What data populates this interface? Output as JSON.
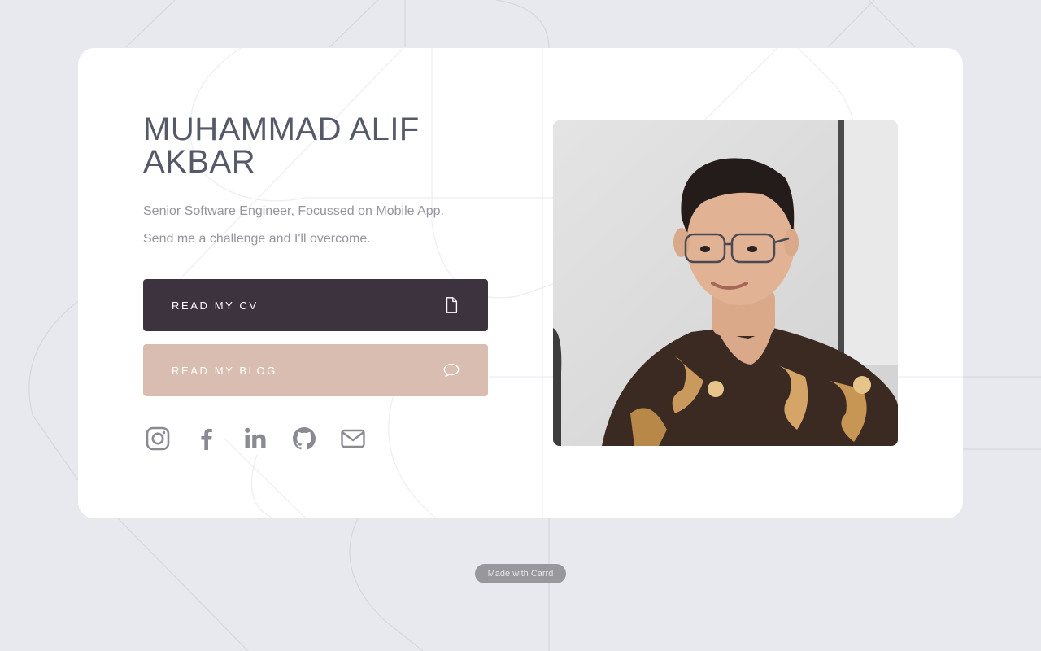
{
  "profile": {
    "name": "MUHAMMAD ALIF AKBAR",
    "tagline": "Senior Software Engineer, Focussed on Mobile App.",
    "motto": "Send me a challenge and I'll overcome."
  },
  "buttons": {
    "cv_label": "READ MY CV",
    "cv_icon": "document-icon",
    "blog_label": "READ MY BLOG",
    "blog_icon": "chat-bubble-icon"
  },
  "socials": [
    {
      "icon": "instagram-icon"
    },
    {
      "icon": "facebook-icon"
    },
    {
      "icon": "linkedin-icon"
    },
    {
      "icon": "github-icon"
    },
    {
      "icon": "email-icon"
    }
  ],
  "photo": {
    "icon": "profile-photo"
  },
  "footer": {
    "badge": "Made with Carrd"
  },
  "colors": {
    "background": "#e8e9ee",
    "card": "#ffffff",
    "title": "#555968",
    "text": "#95959f",
    "cv_button": "#3c333f",
    "blog_button": "#d8bdb0",
    "icons": "#8a8a93",
    "badge": "#97979c"
  }
}
